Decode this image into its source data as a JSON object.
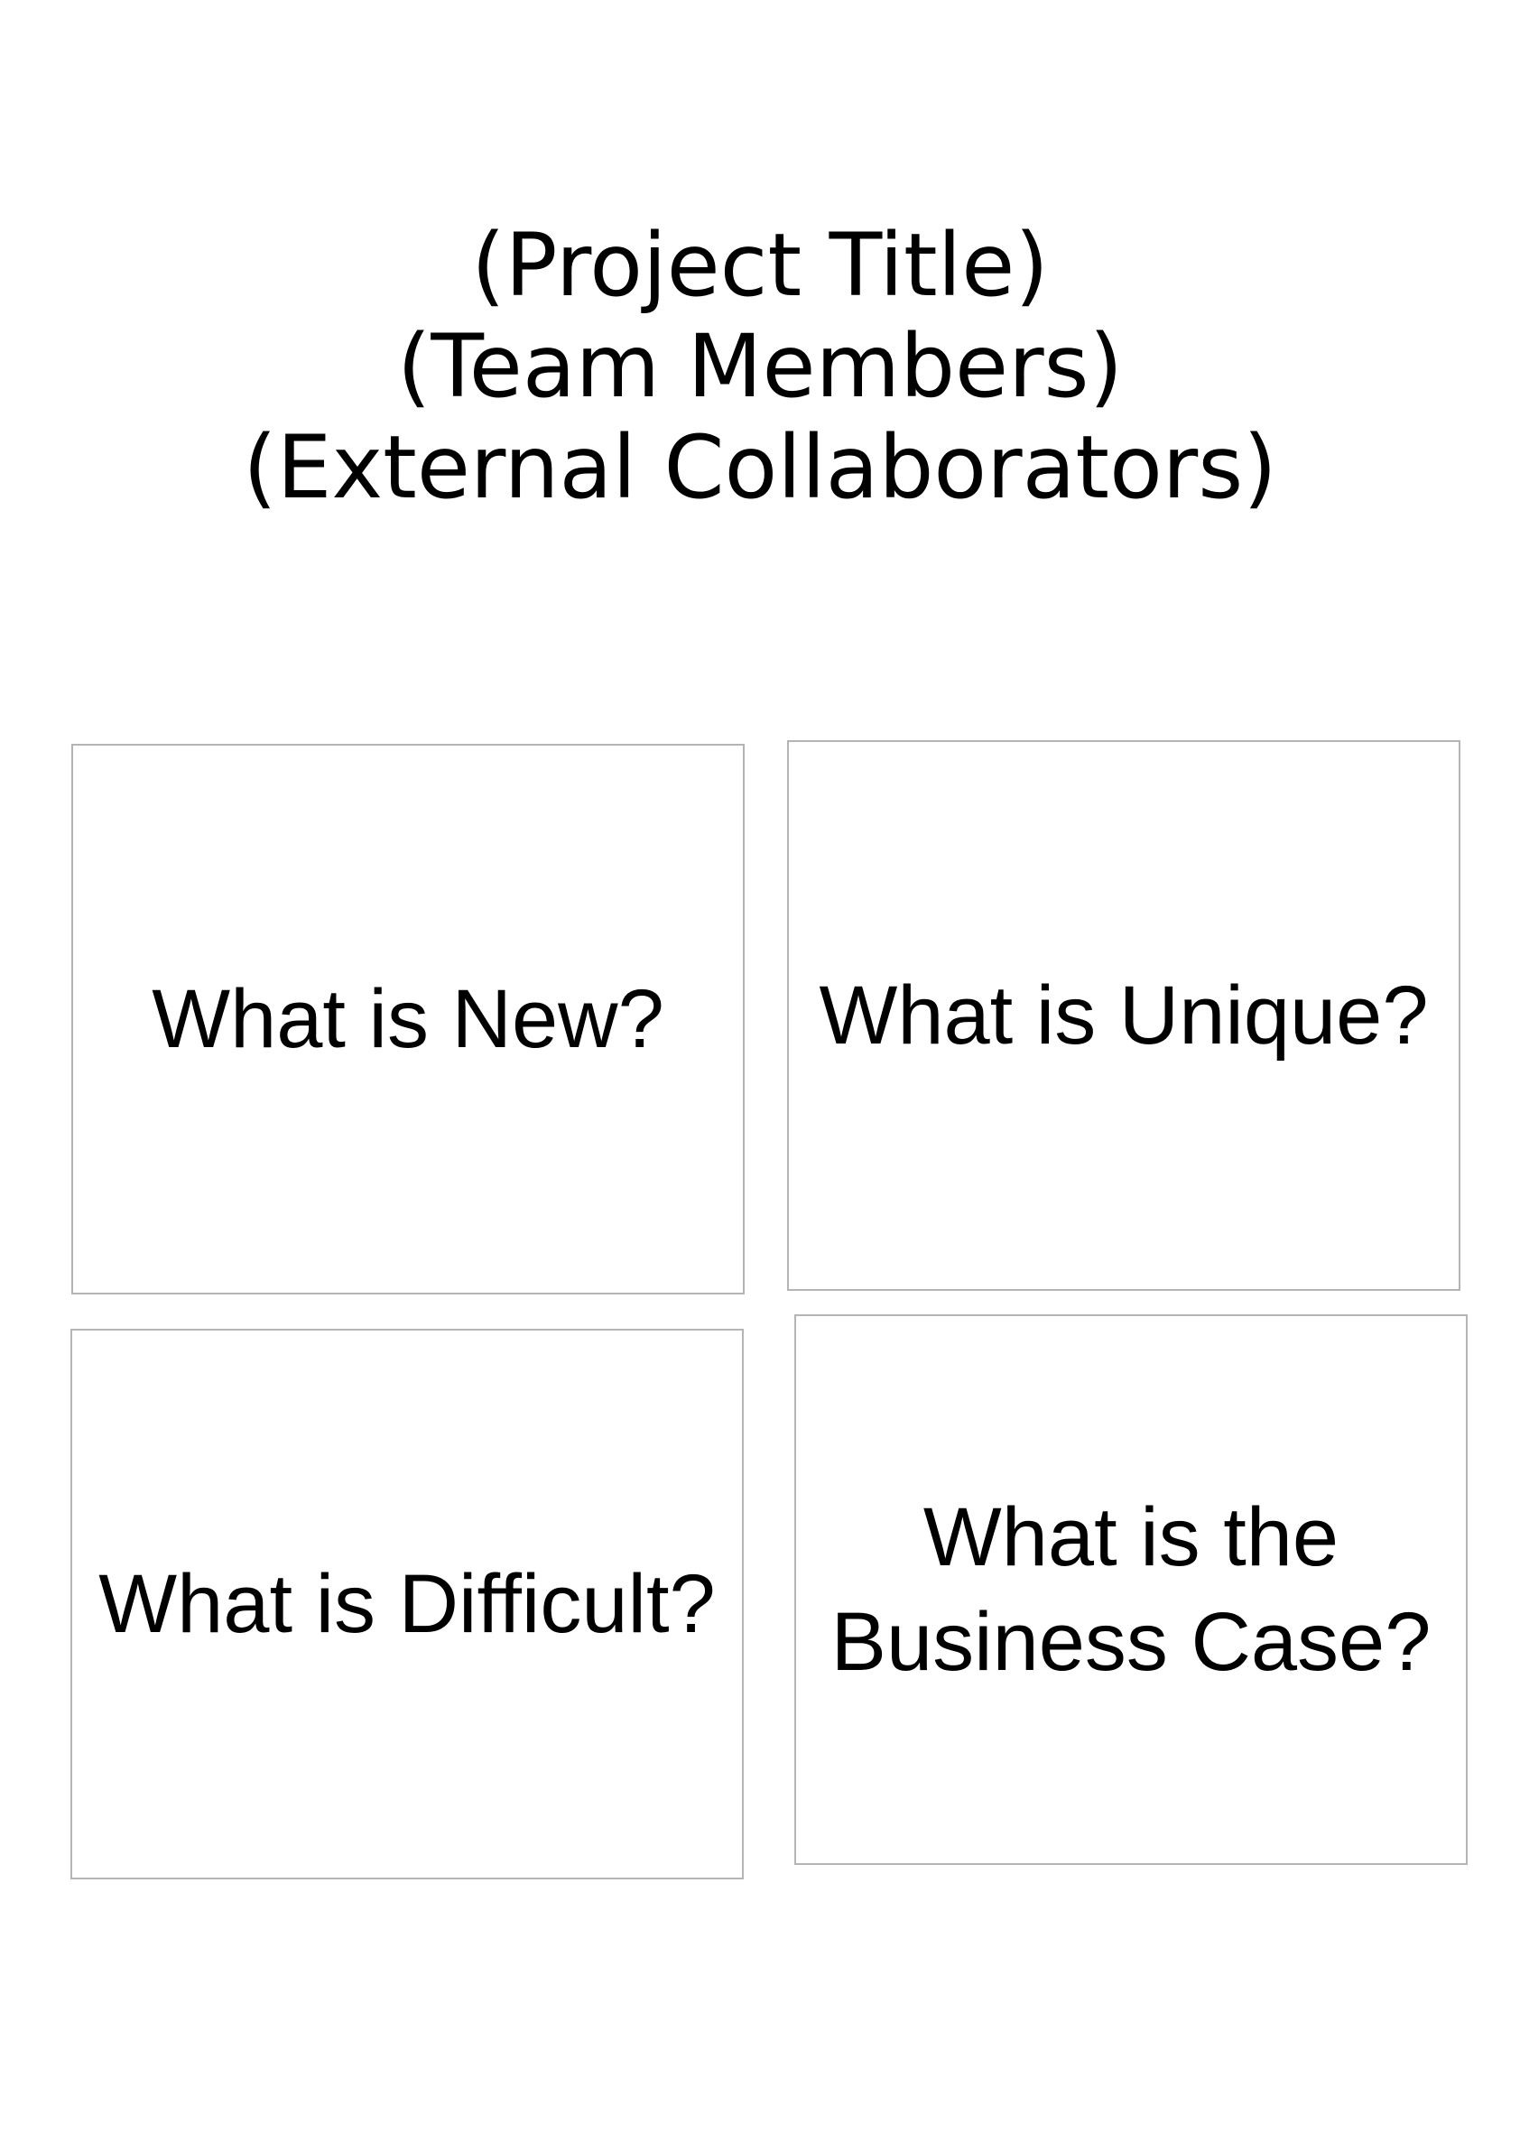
{
  "header": {
    "project_title": "(Project Title)",
    "team_members": "(Team Members)",
    "external_collaborators": "(External Collaborators)"
  },
  "boxes": {
    "new": "What is New?",
    "unique": "What is Unique?",
    "difficult": "What is Difficult?",
    "business_case": "What is the\nBusiness Case?"
  }
}
